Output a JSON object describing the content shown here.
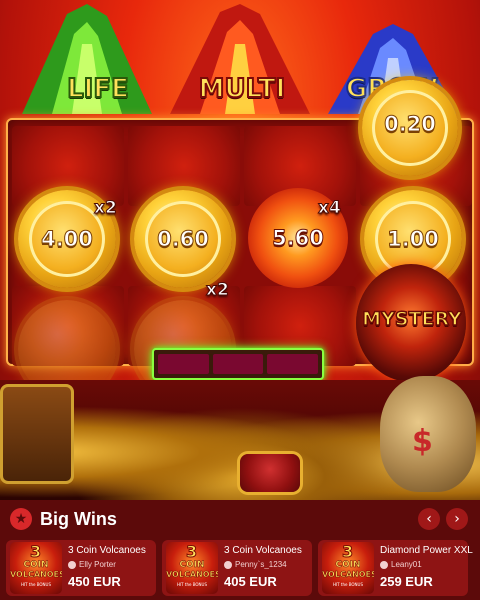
{
  "game": {
    "volcanoes": [
      "LIFE",
      "MULTI",
      "GROW"
    ],
    "coins": [
      {
        "value": "4.00"
      },
      {
        "value": "0.60"
      },
      {
        "value": "5.60"
      },
      {
        "value": "1.00"
      }
    ],
    "top_partial_value": "0.20",
    "multipliers": [
      "x2",
      "x4",
      "x2"
    ],
    "mystery_label": "MYSTERY",
    "progress": {
      "filled": 0,
      "total": 3
    }
  },
  "big_wins": {
    "title": "Big Wins",
    "nav_prev": "‹",
    "nav_next": "›",
    "items": [
      {
        "game": "3 Coin Volcanoes",
        "user": "Elly Porter",
        "amount": "450 EUR"
      },
      {
        "game": "3 Coin Volcanoes",
        "user": "Penny`s_1234",
        "amount": "405 EUR"
      },
      {
        "game": "Diamond Power XXL",
        "user": "Leany01",
        "amount": "259 EUR"
      }
    ],
    "thumb": {
      "num": "3",
      "line1": "COIN",
      "line2": "VOLCANOES",
      "line3": "HIT the BONUS"
    }
  },
  "colors": {
    "panel": "#5c0a0a",
    "card": "#8e1414",
    "accent": "#d8282a"
  }
}
